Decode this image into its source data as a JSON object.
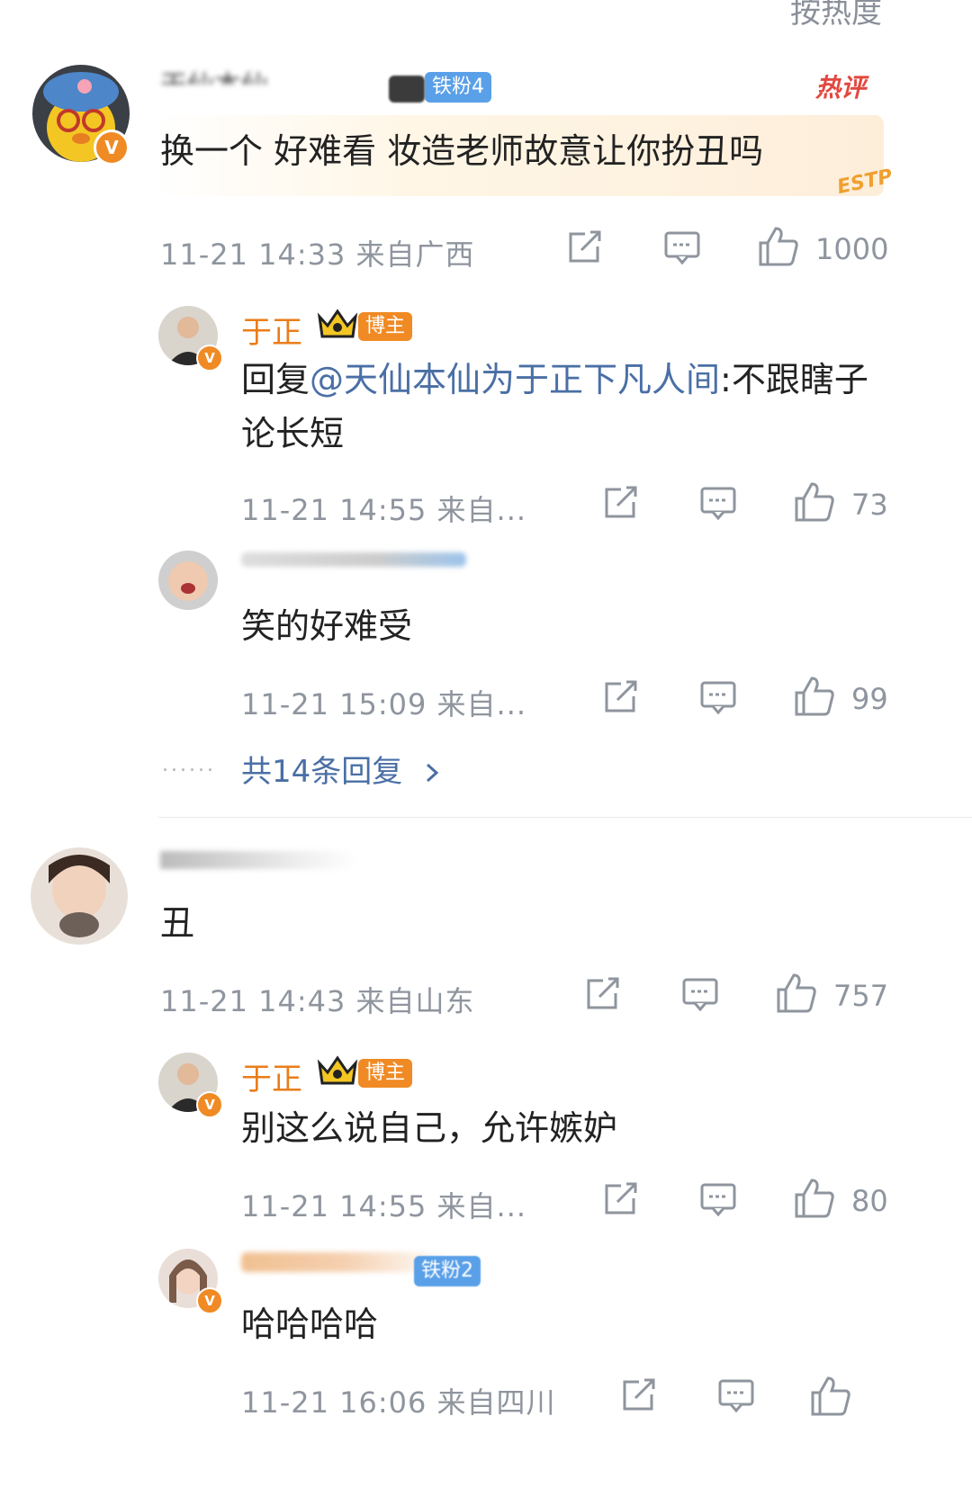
{
  "sort_label": "按热度",
  "comments": [
    {
      "username": "天仙本仙为于正下凡人间",
      "fan_badge": "铁粉4",
      "hot_tag": "热评",
      "text": "换一个 好难看 妆造老师故意让你扮丑吗",
      "decoration": "ESTP",
      "time_location": "11-21 14:33 来自广西",
      "likes": "1000",
      "replies": [
        {
          "username": "于正",
          "badge": "博主",
          "reply_prefix": "回复",
          "mention": "@天仙本仙为于正下凡人间",
          "text": ":不跟瞎子论长短",
          "time_location": "11-21 14:55 来自...",
          "likes": "73"
        },
        {
          "username": "",
          "text": "笑的好难受",
          "time_location": "11-21 15:09 来自...",
          "likes": "99"
        }
      ],
      "more_replies": "共14条回复",
      "more_replies_dots": "......"
    },
    {
      "username": "",
      "text": "丑",
      "time_location": "11-21 14:43 来自山东",
      "likes": "757",
      "replies": [
        {
          "username": "于正",
          "badge": "博主",
          "text": "别这么说自己，允许嫉妒",
          "time_location": "11-21 14:55 来自...",
          "likes": "80"
        },
        {
          "username": "",
          "fan_badge": "铁粉2",
          "text": "哈哈哈哈",
          "time_location": "11-21 16:06 来自四川",
          "likes": ""
        }
      ]
    }
  ],
  "colors": {
    "accent_orange": "#ea7d1a",
    "link_blue": "#4a6fa5",
    "meta_gray": "#8f959e",
    "hot_red": "#e2483f",
    "fan_badge_blue": "#5aa0e8"
  },
  "icons": [
    "share-icon",
    "comment-icon",
    "like-icon",
    "verified-icon",
    "crown-icon",
    "chevron-right-icon"
  ]
}
